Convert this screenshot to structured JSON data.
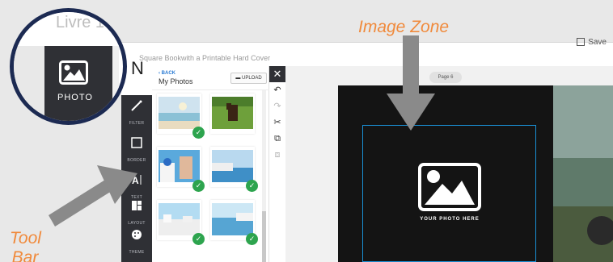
{
  "colors": {
    "accent": "#f08a3c",
    "toolbar_bg": "#2f3035",
    "zone_border": "#1a8fd4",
    "check": "#2da44e",
    "circle_ring": "#1c2a52"
  },
  "callouts": {
    "image_zone": "Image Zone",
    "tool_bar": "Tool Bar"
  },
  "zoom": {
    "title_fragment": "Livre 1",
    "photo_label": "PHOTO",
    "photo_icon": "photo-icon"
  },
  "header": {
    "title_fragment": "N",
    "subtitle": "Square Bookwith a Printable Hard Cover",
    "save_label": "Save"
  },
  "toolbar": {
    "items": [
      {
        "label": "FILTER",
        "icon": "magic-wand-icon"
      },
      {
        "label": "BORDER",
        "icon": "border-icon"
      },
      {
        "label": "TEXT",
        "icon": "text-icon"
      },
      {
        "label": "LAYOUT",
        "icon": "layout-icon"
      },
      {
        "label": "THEME",
        "icon": "palette-icon"
      }
    ]
  },
  "panel": {
    "back_label": "BACK",
    "title": "My Photos",
    "upload_label": "UPLOAD",
    "photos": [
      {
        "scene": "beach",
        "used": true
      },
      {
        "scene": "horse",
        "used": false
      },
      {
        "scene": "santorini-couple",
        "used": true
      },
      {
        "scene": "coast",
        "used": true
      },
      {
        "scene": "village",
        "used": true
      },
      {
        "scene": "seaside",
        "used": true
      }
    ]
  },
  "edit_tools": [
    "undo-icon",
    "redo-icon",
    "cut-icon",
    "copy-icon",
    "paste-icon"
  ],
  "canvas": {
    "page_label": "Page 6",
    "placeholder": "YOUR PHOTO HERE"
  }
}
